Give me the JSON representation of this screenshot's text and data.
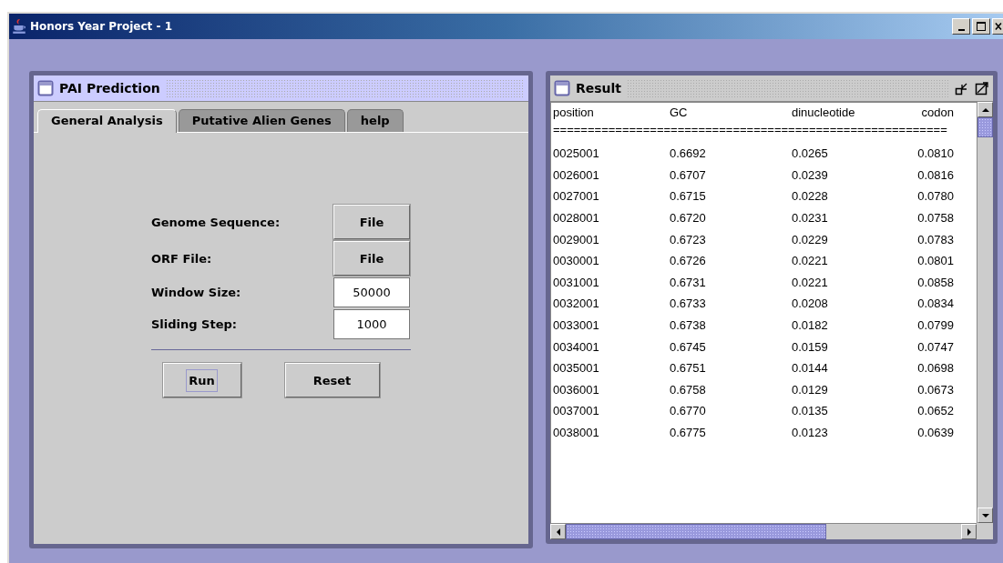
{
  "window": {
    "title": "Honors Year Project - 1"
  },
  "prediction_frame": {
    "title": "PAI Prediction",
    "active": true,
    "tabs": [
      {
        "label": "General Analysis",
        "selected": true
      },
      {
        "label": "Putative Alien Genes",
        "selected": false
      },
      {
        "label": "help",
        "selected": false
      }
    ],
    "fields": [
      {
        "kind": "button",
        "label": "Genome Sequence:",
        "value": "File"
      },
      {
        "kind": "button",
        "label": "ORF File:",
        "value": "File"
      },
      {
        "kind": "input",
        "label": "Window Size:",
        "value": "50000"
      },
      {
        "kind": "input",
        "label": "Sliding Step:",
        "value": "1000"
      }
    ],
    "buttons": [
      {
        "label": "Run",
        "focused": true
      },
      {
        "label": "Reset",
        "focused": false
      }
    ]
  },
  "result_frame": {
    "title": "Result",
    "active": false,
    "columns": [
      "position",
      "GC",
      "dinucleotide",
      "codon"
    ],
    "separator": "=========================================================",
    "rows": [
      [
        "0025001",
        "0.6692",
        "0.0265",
        "0.0810"
      ],
      [
        "0026001",
        "0.6707",
        "0.0239",
        "0.0816"
      ],
      [
        "0027001",
        "0.6715",
        "0.0228",
        "0.0780"
      ],
      [
        "0028001",
        "0.6720",
        "0.0231",
        "0.0758"
      ],
      [
        "0029001",
        "0.6723",
        "0.0229",
        "0.0783"
      ],
      [
        "0030001",
        "0.6726",
        "0.0221",
        "0.0801"
      ],
      [
        "0031001",
        "0.6731",
        "0.0221",
        "0.0858"
      ],
      [
        "0032001",
        "0.6733",
        "0.0208",
        "0.0834"
      ],
      [
        "0033001",
        "0.6738",
        "0.0182",
        "0.0799"
      ],
      [
        "0034001",
        "0.6745",
        "0.0159",
        "0.0747"
      ],
      [
        "0035001",
        "0.6751",
        "0.0144",
        "0.0698"
      ],
      [
        "0036001",
        "0.6758",
        "0.0129",
        "0.0673"
      ],
      [
        "0037001",
        "0.6770",
        "0.0135",
        "0.0652"
      ],
      [
        "0038001",
        "0.6775",
        "0.0123",
        "0.0639"
      ]
    ]
  }
}
